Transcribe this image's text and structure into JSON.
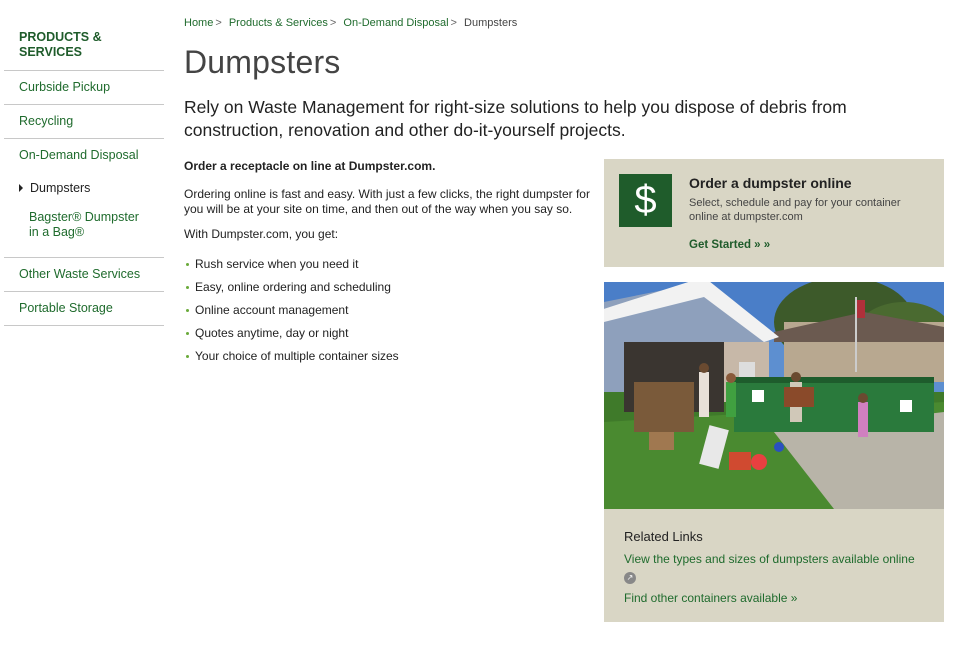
{
  "sidebar": {
    "heading": "PRODUCTS & SERVICES",
    "items": [
      {
        "label": "Curbside Pickup"
      },
      {
        "label": "Recycling"
      },
      {
        "label": "On-Demand Disposal"
      }
    ],
    "current": "Dumpsters",
    "subitem": "Bagster® Dumpster in a Bag®",
    "after": [
      {
        "label": "Other Waste Services"
      },
      {
        "label": "Portable Storage"
      }
    ]
  },
  "breadcrumb": {
    "home": "Home",
    "products": "Products & Services",
    "disposal": "On-Demand Disposal",
    "current": "Dumpsters",
    "sep": ">"
  },
  "page": {
    "title": "Dumpsters",
    "intro": "Rely on Waste Management for right-size solutions to help you dispose of debris from construction, renovation and other do-it-yourself projects."
  },
  "main": {
    "lead": "Order a receptacle on line at Dumpster.com.",
    "para1": "Ordering online is fast and easy. With just a few clicks, the right dumpster for you will be at your site on time, and then out of the way when you say so.",
    "para2": "With Dumpster.com, you get:",
    "bullets": [
      "Rush service when you need it",
      "Easy, online ordering and scheduling",
      "Online account management",
      "Quotes anytime, day or night",
      "Your choice of multiple container sizes"
    ]
  },
  "promo": {
    "icon": "dollar-icon",
    "symbol": "$",
    "title": "Order a dumpster online",
    "desc": "Select, schedule and pay for your container online at dumpster.com",
    "cta": "Get Started » »"
  },
  "related": {
    "title": "Related Links",
    "link1": "View the types and sizes of dumpsters available online",
    "link2": "Find other containers available »"
  },
  "colors": {
    "brand_green": "#1f5c2b",
    "link_green": "#1f6b2d",
    "panel_beige": "#d9d6c5",
    "dumpster_green": "#2a7a3c"
  }
}
